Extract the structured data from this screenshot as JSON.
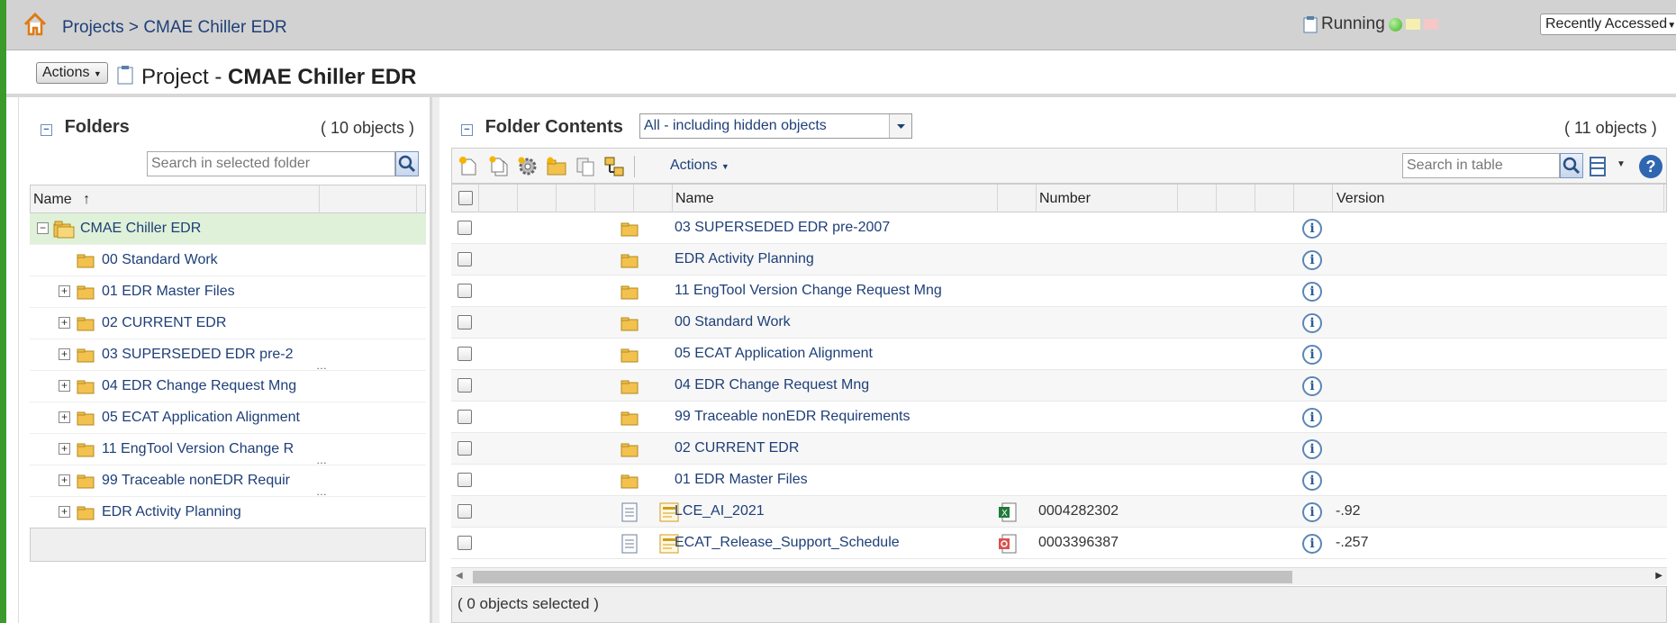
{
  "topbar": {
    "breadcrumb_projects": "Projects",
    "breadcrumb_sep": ">",
    "breadcrumb_current": "CMAE Chiller EDR",
    "status_label": "Running",
    "recently_accessed": "Recently Accessed"
  },
  "titlebar": {
    "actions_label": "Actions",
    "title_prefix": "Project - ",
    "title_name": "CMAE Chiller EDR"
  },
  "folders": {
    "title": "Folders",
    "count": "( 10 objects )",
    "search_placeholder": "Search in selected folder",
    "col_name": "Name",
    "sort_indicator": "↑",
    "root": "CMAE Chiller EDR",
    "items": [
      {
        "label": "00 Standard Work",
        "expandable": false,
        "truncated": false
      },
      {
        "label": "01 EDR Master Files",
        "expandable": true,
        "truncated": false
      },
      {
        "label": "02 CURRENT EDR",
        "expandable": true,
        "truncated": false
      },
      {
        "label": "03 SUPERSEDED EDR pre-2",
        "expandable": true,
        "truncated": true
      },
      {
        "label": "04 EDR Change Request Mng",
        "expandable": true,
        "truncated": false
      },
      {
        "label": "05 ECAT Application Alignment",
        "expandable": true,
        "truncated": false
      },
      {
        "label": "11 EngTool Version Change R",
        "expandable": true,
        "truncated": true
      },
      {
        "label": "99 Traceable nonEDR Requir",
        "expandable": true,
        "truncated": true
      },
      {
        "label": "EDR Activity Planning",
        "expandable": true,
        "truncated": false
      }
    ]
  },
  "contents": {
    "title": "Folder Contents",
    "filter_value": "All - including hidden objects",
    "count": "( 11 objects )",
    "toolbar_actions": "Actions",
    "search_placeholder": "Search in table",
    "col_name": "Name",
    "col_number": "Number",
    "col_version": "Version",
    "rows": [
      {
        "name": "03 SUPERSEDED EDR pre-2007",
        "type": "folder",
        "number": "",
        "version": ""
      },
      {
        "name": "EDR Activity Planning",
        "type": "folder",
        "number": "",
        "version": ""
      },
      {
        "name": "11 EngTool Version Change Request Mng",
        "type": "folder",
        "number": "",
        "version": ""
      },
      {
        "name": "00 Standard Work",
        "type": "folder",
        "number": "",
        "version": ""
      },
      {
        "name": "05 ECAT Application Alignment",
        "type": "folder",
        "number": "",
        "version": ""
      },
      {
        "name": "04 EDR Change Request Mng",
        "type": "folder",
        "number": "",
        "version": ""
      },
      {
        "name": "99 Traceable nonEDR Requirements",
        "type": "folder",
        "number": "",
        "version": ""
      },
      {
        "name": "02 CURRENT EDR",
        "type": "folder",
        "number": "",
        "version": ""
      },
      {
        "name": "01 EDR Master Files",
        "type": "folder",
        "number": "",
        "version": ""
      },
      {
        "name": "LCE_AI_2021",
        "type": "document",
        "file": "excel",
        "number": "0004282302",
        "version": "-.92"
      },
      {
        "name": "ECAT_Release_Support_Schedule",
        "type": "document",
        "file": "pdf",
        "number": "0003396387",
        "version": "-.257"
      }
    ],
    "selected_status": "( 0 objects selected )"
  },
  "colors": {
    "link": "#1e3f77",
    "accent_green": "#3a9a2a",
    "selected_row": "#dff1d8",
    "folder_yellow": "#f2c14e"
  }
}
